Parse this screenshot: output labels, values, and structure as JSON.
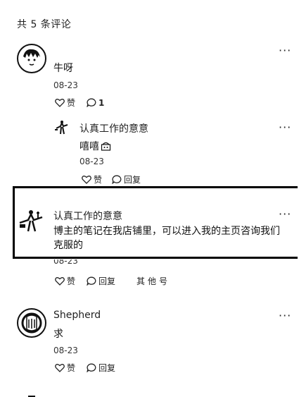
{
  "header": {
    "title": "共 5 条评论"
  },
  "comments": [
    {
      "author": "",
      "text": "牛呀",
      "date": "08-23",
      "like_label": "赞",
      "reply_count": "1",
      "more": "···"
    },
    {
      "author": "认真工作的意意",
      "text": "嘻嘻",
      "date": "08-23",
      "like_label": "赞",
      "reply_label": "回复",
      "more": "···"
    },
    {
      "author": "认真工作的意意",
      "text": "博主的笔记在我店铺里，可以进入我的主页咨询我们克服的",
      "date": "08-23",
      "like_label": "赞",
      "reply_label": "回复",
      "more": "···",
      "side_note": "其他号"
    },
    {
      "author": "Shepherd",
      "text": "求",
      "date": "08-23",
      "like_label": "赞",
      "reply_label": "回复",
      "more": "···"
    }
  ]
}
